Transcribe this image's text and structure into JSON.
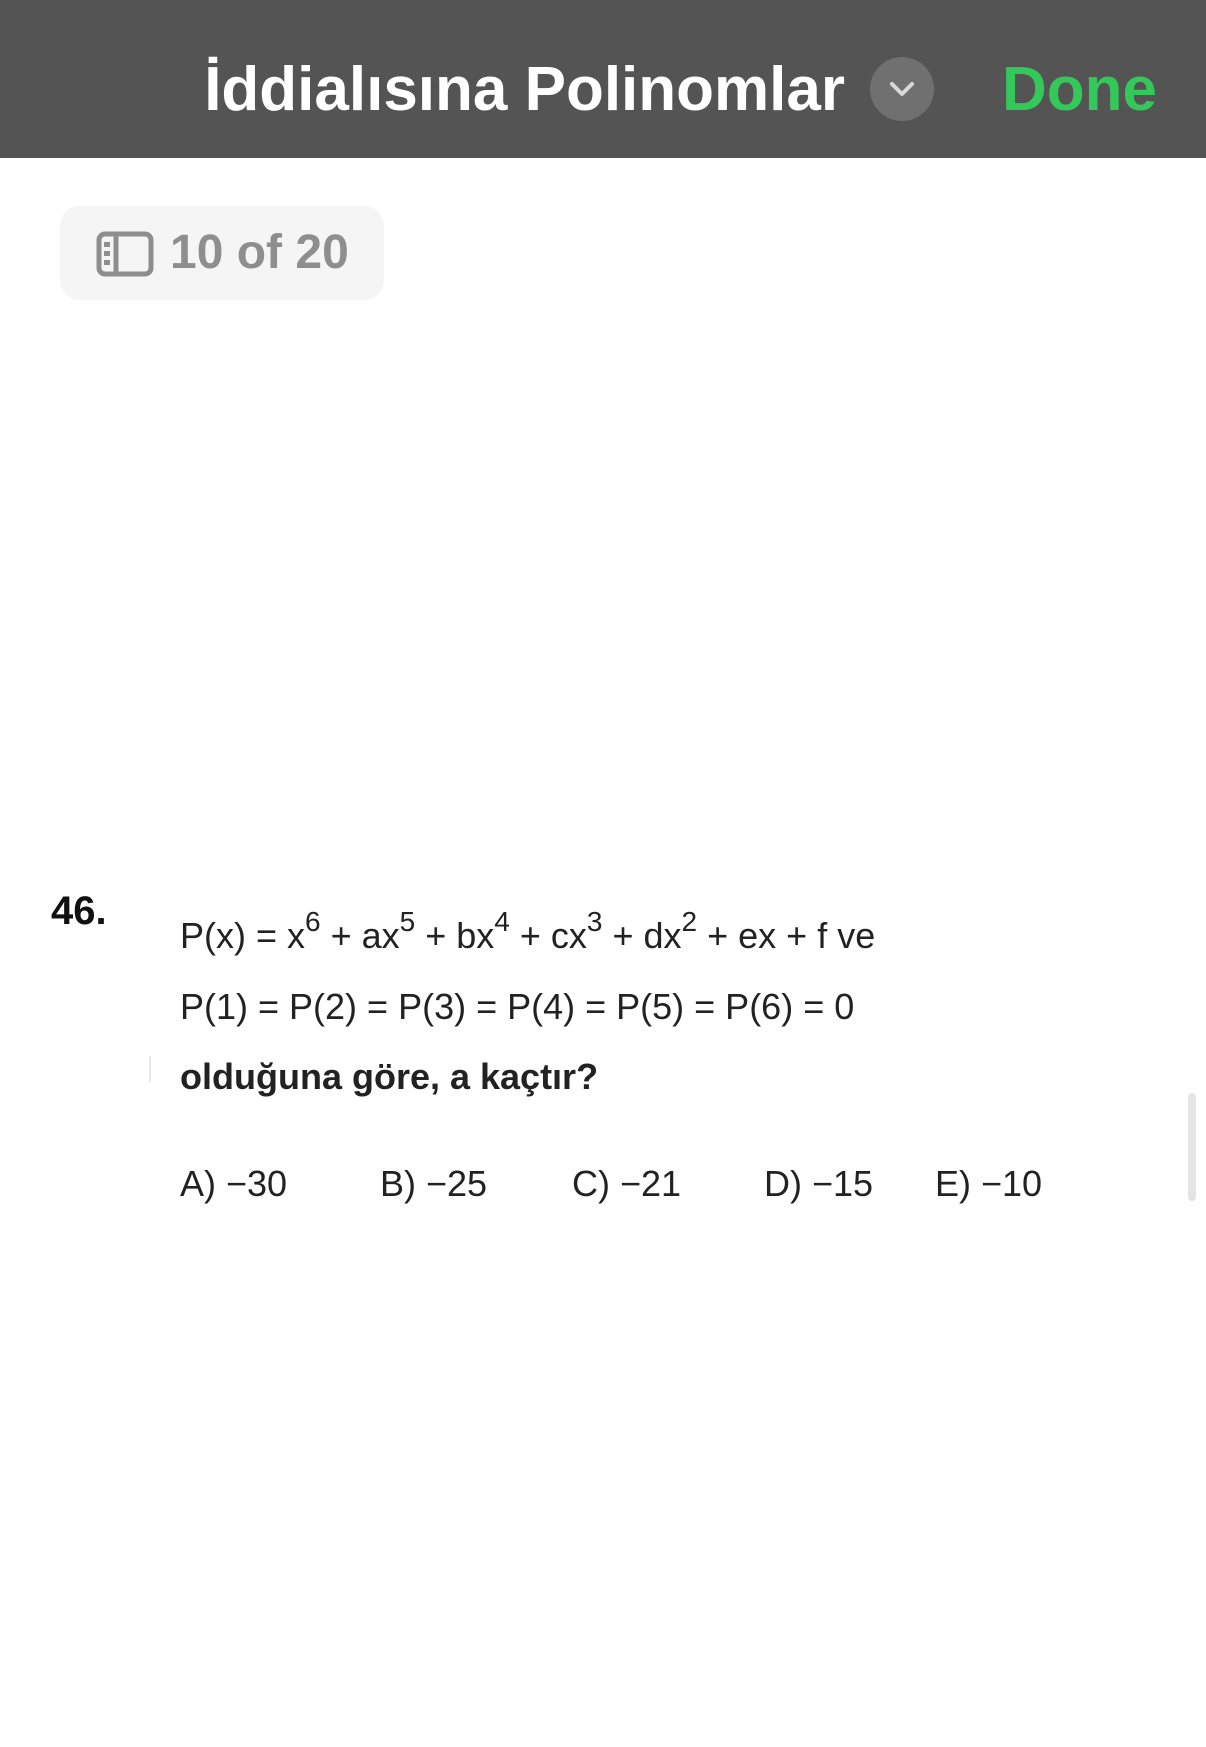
{
  "header": {
    "title": "İddialısına Polinomlar",
    "done_label": "Done",
    "done_color": "#34c759",
    "title_menu_icon": "chevron-down-icon"
  },
  "page_indicator": {
    "icon": "sidebar-icon",
    "label": "10 of 20"
  },
  "question": {
    "number": "46.",
    "line1_parts": [
      "P(x) = x",
      "6",
      " + ax",
      "5",
      " + bx",
      "4",
      " + cx",
      "3",
      " + dx",
      "2",
      " + ex + f  ve"
    ],
    "line2": "P(1) = P(2) = P(3) = P(4) = P(5) = P(6) = 0",
    "line3": "olduğuna göre,  a  kaçtır?",
    "options": [
      {
        "label": "A) −30"
      },
      {
        "label": "B) −25"
      },
      {
        "label": "C) −21"
      },
      {
        "label": "D) −15"
      },
      {
        "label": "E) −10"
      }
    ]
  }
}
